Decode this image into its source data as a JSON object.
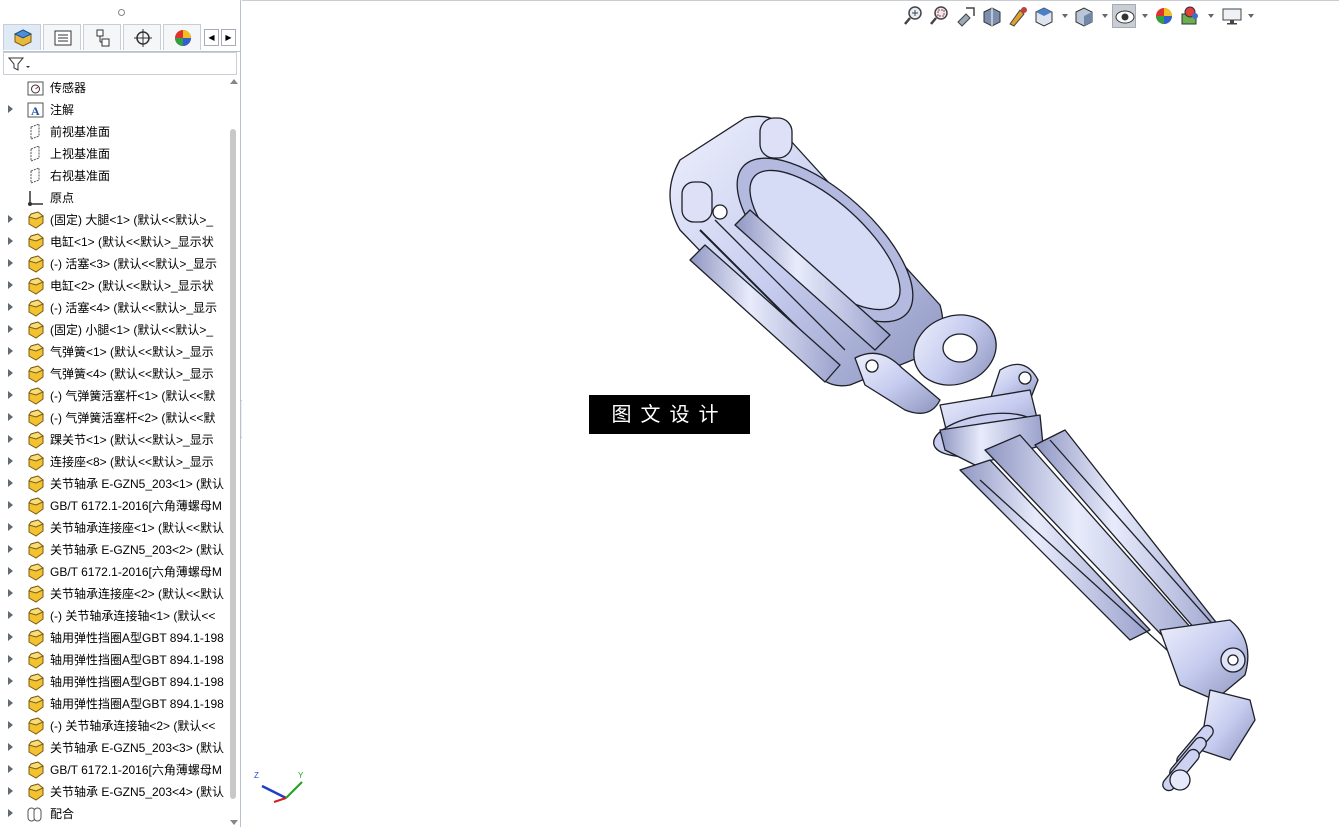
{
  "feature_tree": {
    "items": [
      {
        "label": "传感器",
        "icon": "sensor-icon",
        "expandable": false
      },
      {
        "label": "注解",
        "icon": "annotation-icon",
        "expandable": true
      },
      {
        "label": "前视基准面",
        "icon": "plane-icon",
        "expandable": false
      },
      {
        "label": "上视基准面",
        "icon": "plane-icon",
        "expandable": false
      },
      {
        "label": "右视基准面",
        "icon": "plane-icon",
        "expandable": false
      },
      {
        "label": "原点",
        "icon": "origin-icon",
        "expandable": false
      },
      {
        "label": "(固定) 大腿<1> (默认<<默认>_",
        "icon": "part-icon",
        "expandable": true
      },
      {
        "label": "电缸<1> (默认<<默认>_显示状",
        "icon": "part-icon",
        "expandable": true
      },
      {
        "label": "(-) 活塞<3> (默认<<默认>_显示",
        "icon": "part-icon",
        "expandable": true
      },
      {
        "label": "电缸<2> (默认<<默认>_显示状",
        "icon": "part-icon",
        "expandable": true
      },
      {
        "label": "(-) 活塞<4> (默认<<默认>_显示",
        "icon": "part-icon",
        "expandable": true
      },
      {
        "label": "(固定) 小腿<1> (默认<<默认>_",
        "icon": "part-icon",
        "expandable": true
      },
      {
        "label": "气弹簧<1> (默认<<默认>_显示",
        "icon": "part-icon",
        "expandable": true
      },
      {
        "label": "气弹簧<4> (默认<<默认>_显示",
        "icon": "part-icon",
        "expandable": true
      },
      {
        "label": "(-) 气弹簧活塞杆<1> (默认<<默",
        "icon": "part-icon",
        "expandable": true
      },
      {
        "label": "(-) 气弹簧活塞杆<2> (默认<<默",
        "icon": "part-icon",
        "expandable": true
      },
      {
        "label": "踝关节<1> (默认<<默认>_显示",
        "icon": "part-icon",
        "expandable": true
      },
      {
        "label": "连接座<8> (默认<<默认>_显示",
        "icon": "part-icon",
        "expandable": true
      },
      {
        "label": "关节轴承 E-GZN5_203<1> (默认",
        "icon": "part-icon",
        "expandable": true
      },
      {
        "label": "GB/T 6172.1-2016[六角薄螺母M",
        "icon": "part-icon",
        "expandable": true
      },
      {
        "label": "关节轴承连接座<1> (默认<<默认",
        "icon": "part-icon",
        "expandable": true
      },
      {
        "label": "关节轴承 E-GZN5_203<2> (默认",
        "icon": "part-icon",
        "expandable": true
      },
      {
        "label": "GB/T 6172.1-2016[六角薄螺母M",
        "icon": "part-icon",
        "expandable": true
      },
      {
        "label": "关节轴承连接座<2> (默认<<默认",
        "icon": "part-icon",
        "expandable": true
      },
      {
        "label": "(-) 关节轴承连接轴<1> (默认<<",
        "icon": "part-icon",
        "expandable": true
      },
      {
        "label": "轴用弹性挡圈A型GBT 894.1-198",
        "icon": "part-icon",
        "expandable": true
      },
      {
        "label": "轴用弹性挡圈A型GBT 894.1-198",
        "icon": "part-icon",
        "expandable": true
      },
      {
        "label": "轴用弹性挡圈A型GBT 894.1-198",
        "icon": "part-icon",
        "expandable": true
      },
      {
        "label": "轴用弹性挡圈A型GBT 894.1-198",
        "icon": "part-icon",
        "expandable": true
      },
      {
        "label": "(-) 关节轴承连接轴<2> (默认<<",
        "icon": "part-icon",
        "expandable": true
      },
      {
        "label": "关节轴承 E-GZN5_203<3> (默认",
        "icon": "part-icon",
        "expandable": true
      },
      {
        "label": "GB/T 6172.1-2016[六角薄螺母M",
        "icon": "part-icon",
        "expandable": true
      },
      {
        "label": "关节轴承 E-GZN5_203<4> (默认",
        "icon": "part-icon",
        "expandable": true
      },
      {
        "label": "配合",
        "icon": "mates-icon",
        "expandable": true
      }
    ]
  },
  "watermark": {
    "text": "图文设计"
  },
  "triad": {
    "z": "Z",
    "y": "Y"
  },
  "colors": {
    "part_fill": "#c8cef0",
    "part_edge": "#20222a",
    "tree_part_icon": "#f3c231"
  }
}
